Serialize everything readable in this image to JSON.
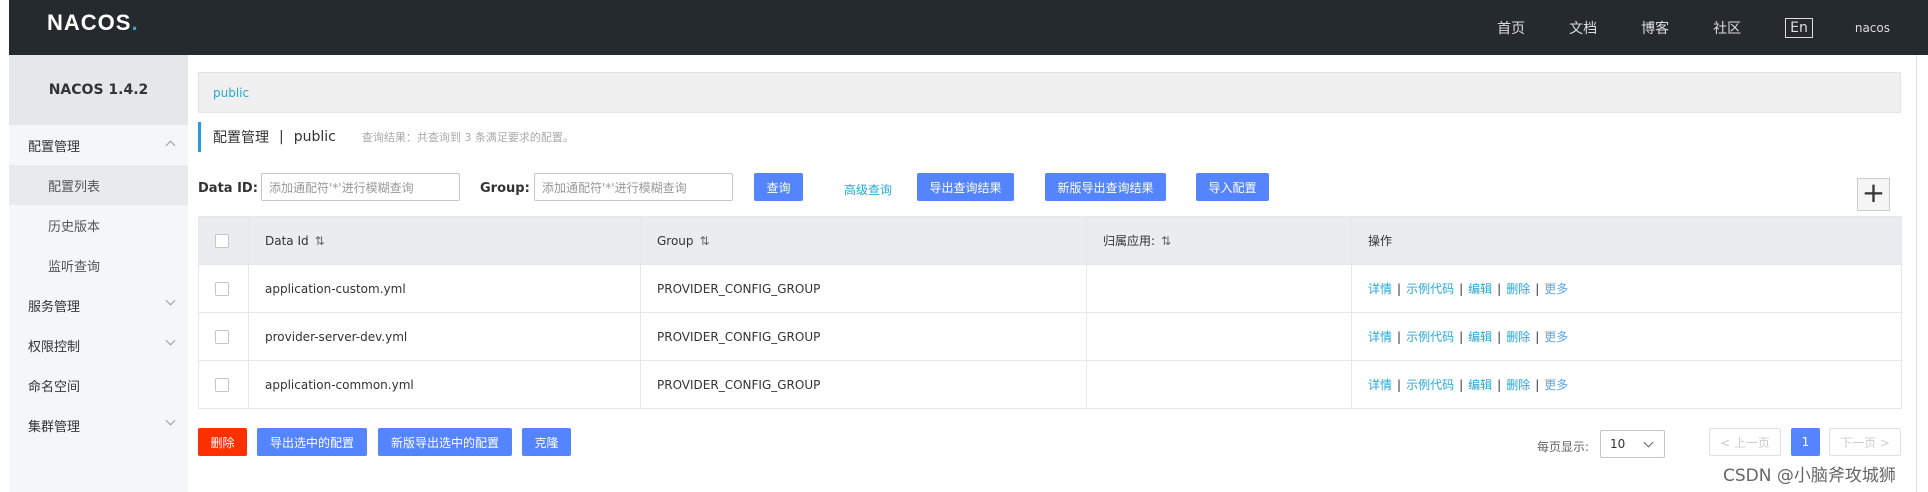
{
  "topnav": {
    "logo_main": "NACOS",
    "logo_dot": ".",
    "links": [
      "首页",
      "文档",
      "博客",
      "社区"
    ],
    "lang": "En",
    "user": "nacos"
  },
  "sidebar": {
    "title": "NACOS 1.4.2",
    "items": [
      {
        "label": "配置管理"
      },
      {
        "label": "配置列表"
      },
      {
        "label": "历史版本"
      },
      {
        "label": "监听查询"
      },
      {
        "label": "服务管理"
      },
      {
        "label": "权限控制"
      },
      {
        "label": "命名空间"
      },
      {
        "label": "集群管理"
      }
    ]
  },
  "breadcrumb": "public",
  "header": {
    "title": "配置管理",
    "separator": "|",
    "namespace": "public",
    "info": "查询结果：共查询到 3 条满足要求的配置。"
  },
  "filters": {
    "dataid_label": "Data ID:",
    "dataid_placeholder": "添加通配符'*'进行模糊查询",
    "group_label": "Group:",
    "group_placeholder": "添加通配符'*'进行模糊查询",
    "query_button": "查询",
    "advanced_link": "高级查询",
    "export_button": "导出查询结果",
    "export_new_button": "新版导出查询结果",
    "import_button": "导入配置",
    "add_symbol": "+"
  },
  "table": {
    "columns": [
      "Data Id",
      "Group",
      "归属应用:",
      "操作"
    ],
    "sort_symbol": "⇅",
    "rows": [
      {
        "data_id": "application-custom.yml",
        "group": "PROVIDER_CONFIG_GROUP",
        "app": ""
      },
      {
        "data_id": "provider-server-dev.yml",
        "group": "PROVIDER_CONFIG_GROUP",
        "app": ""
      },
      {
        "data_id": "application-common.yml",
        "group": "PROVIDER_CONFIG_GROUP",
        "app": ""
      }
    ],
    "ops": {
      "detail": "详情",
      "sample": "示例代码",
      "edit": "编辑",
      "delete": "删除",
      "more": "更多",
      "pipe": "|"
    }
  },
  "bottom": {
    "delete_button": "删除",
    "export_selected": "导出选中的配置",
    "export_selected_new": "新版导出选中的配置",
    "clone_button": "克隆",
    "per_page_label": "每页显示:",
    "per_page_value": "10",
    "prev": "< 上一页",
    "current_page": "1",
    "next": "下一页 >"
  },
  "watermark": "CSDN @小脑斧攻城狮",
  "colors": {
    "primary": "#5584ff",
    "danger": "#ff3000",
    "link": "#27a8d8",
    "topbar": "#252a2f"
  }
}
